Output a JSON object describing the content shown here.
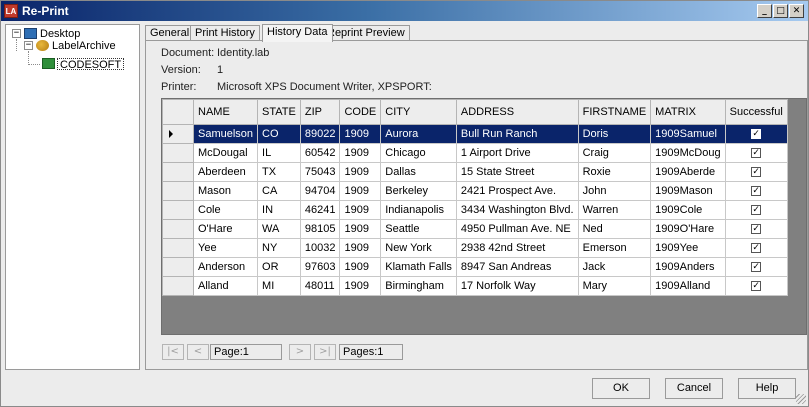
{
  "window": {
    "title": "Re-Print",
    "app_icon_text": "LA",
    "min": "_",
    "max": "□",
    "close": "✕"
  },
  "tree": {
    "items": [
      {
        "label": "Desktop",
        "expander": "−"
      },
      {
        "label": "LabelArchive",
        "expander": "−"
      },
      {
        "label": "CODESOFT"
      }
    ]
  },
  "tabs": [
    "General",
    "Print History",
    "History Data",
    "Reprint Preview"
  ],
  "active_tab": "History Data",
  "meta": {
    "document_label": "Document:",
    "document_value": "Identity.lab",
    "version_label": "Version:",
    "version_value": "1",
    "printer_label": "Printer:",
    "printer_value": "Microsoft XPS Document Writer, XPSPORT:"
  },
  "table": {
    "columns": [
      "NAME",
      "STATE",
      "ZIP",
      "CODE",
      "CITY",
      "ADDRESS",
      "FIRSTNAME",
      "MATRIX",
      "Successful"
    ],
    "rows": [
      [
        "Samuelson",
        "CO",
        "89022",
        "1909",
        "Aurora",
        "Bull Run Ranch",
        "Doris",
        "1909Samuel",
        "✓"
      ],
      [
        "McDougal",
        "IL",
        "60542",
        "1909",
        "Chicago",
        "1 Airport Drive",
        "Craig",
        "1909McDoug",
        "✓"
      ],
      [
        "Aberdeen",
        "TX",
        "75043",
        "1909",
        "Dallas",
        "15 State Street",
        "Roxie",
        "1909Aberde",
        "✓"
      ],
      [
        "Mason",
        "CA",
        "94704",
        "1909",
        "Berkeley",
        "2421 Prospect Ave.",
        "John",
        "1909Mason",
        "✓"
      ],
      [
        "Cole",
        "IN",
        "46241",
        "1909",
        "Indianapolis",
        "3434 Washington Blvd.",
        "Warren",
        "1909Cole",
        "✓"
      ],
      [
        "O'Hare",
        "WA",
        "98105",
        "1909",
        "Seattle",
        "4950 Pullman Ave. NE",
        "Ned",
        "1909O'Hare",
        "✓"
      ],
      [
        "Yee",
        "NY",
        "10032",
        "1909",
        "New York",
        "2938 42nd Street",
        "Emerson",
        "1909Yee",
        "✓"
      ],
      [
        "Anderson",
        "OR",
        "97603",
        "1909",
        "Klamath Falls",
        "8947 San Andreas",
        "Jack",
        "1909Anders",
        "✓"
      ],
      [
        "Alland",
        "MI",
        "48011",
        "1909",
        "Birmingham",
        "17 Norfolk Way",
        "Mary",
        "1909Alland",
        "✓"
      ]
    ],
    "selected_row": 0
  },
  "pager": {
    "first": "|<",
    "prev": "<",
    "page": "Page:1",
    "next": ">",
    "last": ">|",
    "pages": "Pages:1"
  },
  "buttons": {
    "ok": "OK",
    "cancel": "Cancel",
    "help": "Help"
  },
  "colors": {
    "selection": "#0a246a",
    "titlebar": "#0a246a",
    "grid_bg": "#808080"
  }
}
